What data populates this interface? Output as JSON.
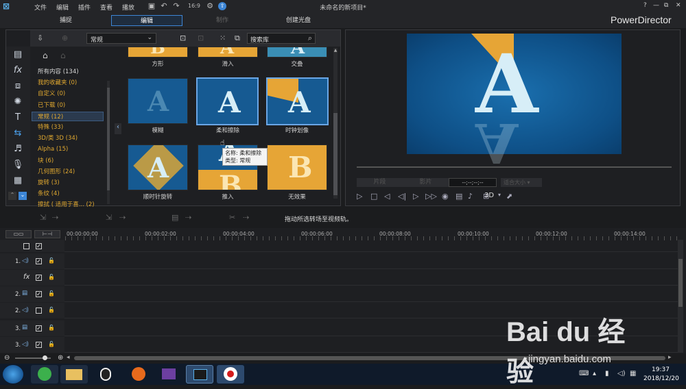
{
  "menu": {
    "file": "文件",
    "edit": "编辑",
    "plugins": "插件",
    "view": "查看",
    "play": "播放"
  },
  "window_title": "未命名的新项目*",
  "app_name": "PowerDirector",
  "modes": {
    "capture": "捕捉",
    "edit": "编辑",
    "produce": "制作",
    "disc": "创建光盘"
  },
  "window_controls": {
    "help": "?",
    "min": "—",
    "restore": "⧉",
    "close": "✕"
  },
  "library": {
    "dropdown": "常规",
    "search_placeholder": "搜索库"
  },
  "categories": [
    {
      "label": "所有内容 (134)",
      "color": "#d8d8d8"
    },
    {
      "label": "我的收藏夹  (0)",
      "color": "#e0a830"
    },
    {
      "label": "自定义  (0)",
      "color": "#e0a830"
    },
    {
      "label": "已下载  (0)",
      "color": "#e0a830"
    },
    {
      "label": "常规  (12)",
      "color": "#e0a830"
    },
    {
      "label": "特殊  (33)",
      "color": "#e0a830"
    },
    {
      "label": "3D/类 3D  (34)",
      "color": "#e0a830"
    },
    {
      "label": "Alpha  (15)",
      "color": "#e0a830"
    },
    {
      "label": "块  (6)",
      "color": "#e0a830"
    },
    {
      "label": "几何图形  (24)",
      "color": "#e0a830"
    },
    {
      "label": "旋转  (3)",
      "color": "#e0a830"
    },
    {
      "label": "条纹  (4)",
      "color": "#e0a830"
    },
    {
      "label": "擦拭 ( 适用于喜...  (2)",
      "color": "#e0a830"
    }
  ],
  "thumbs": {
    "row0": [
      "方形",
      "滑入",
      "交叠"
    ],
    "row1": [
      "模糊",
      "柔和擦除",
      "时钟划像"
    ],
    "row2": [
      "顺时针旋转",
      "推入",
      "无效果"
    ]
  },
  "tooltip": {
    "name": "名称: 柔和擦除",
    "type": "类型: 常规"
  },
  "preview": {
    "timecode": "--;--;--;--",
    "btn_clip": "片段",
    "btn_movie": "影片",
    "fit": "适合大小",
    "mode3d": "3D"
  },
  "status_message": "拖动所选转场至视频轨。",
  "ruler": [
    "00:00:00:00",
    "00:00:02:00",
    "00:00:04:00",
    "00:00:06:00",
    "00:00:08:00",
    "00:00:10:00",
    "00:00:12:00",
    "00:00:14:00"
  ],
  "tracks": [
    "1.",
    "2.",
    "2.",
    "3.",
    "3."
  ],
  "taskbar": {
    "time": "19:37",
    "date": "2018/12/20"
  },
  "watermark": {
    "brand": "Bai du 经验",
    "url": "jingyan.baidu.com"
  },
  "colors": {
    "accent": "#3d86d6",
    "orange": "#e0a830",
    "blue": "#165a92"
  }
}
